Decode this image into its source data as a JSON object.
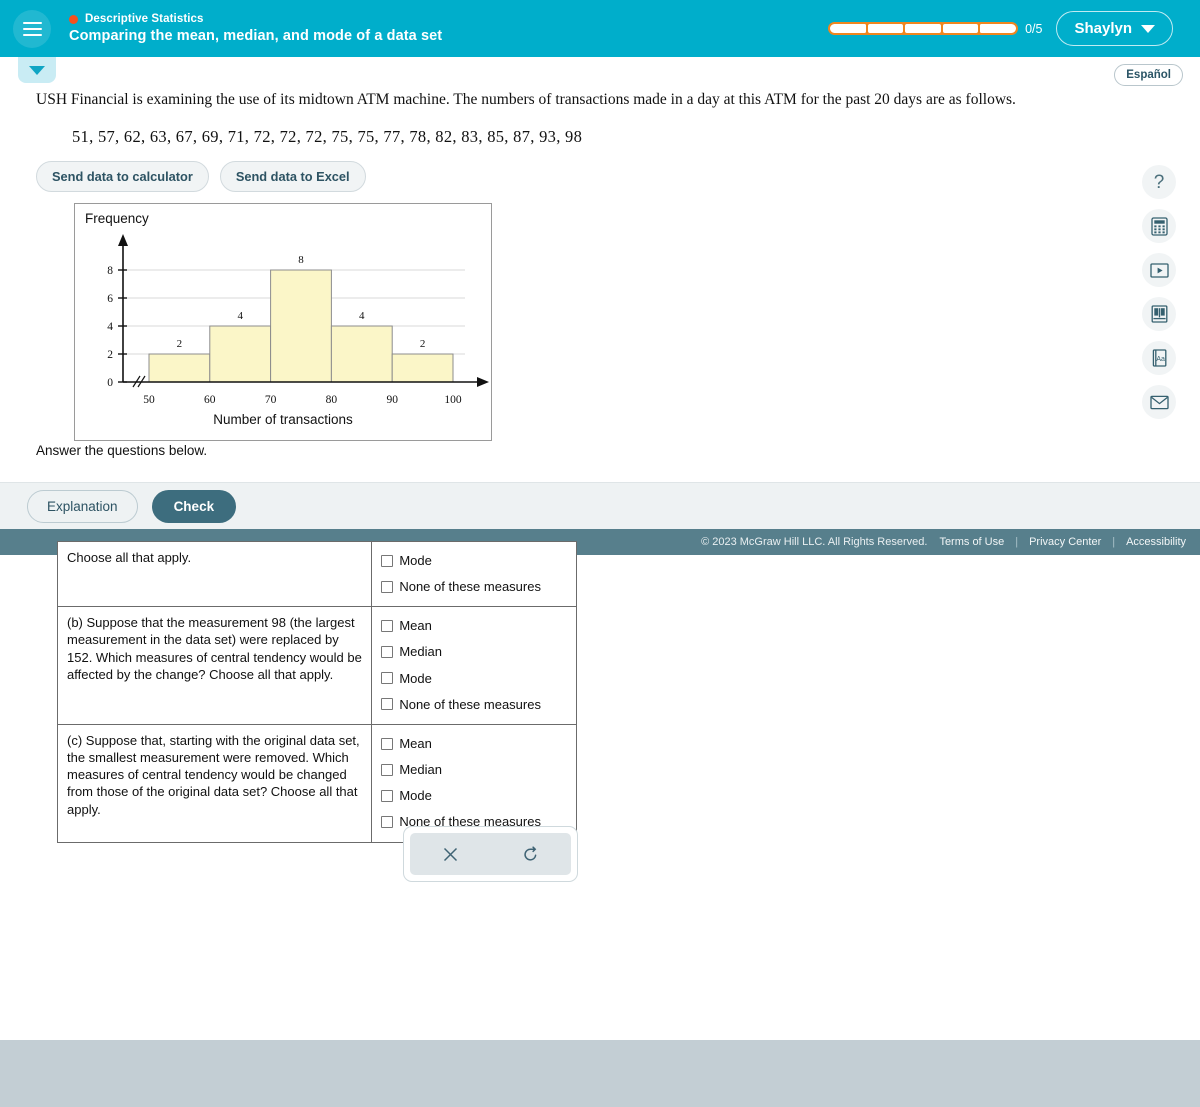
{
  "header": {
    "menu_icon": "hamburger-icon",
    "subject": "Descriptive Statistics",
    "lesson": "Comparing the mean, median, and mode of a data set",
    "progress_label": "0/5",
    "progress_segments": 5,
    "progress_filled": 0,
    "user_name": "Shaylyn",
    "accent_color": "#00aecb",
    "progress_color": "#f0861f"
  },
  "controls": {
    "collapse_tab": "chevron-down-icon",
    "espanol_label": "Español"
  },
  "rail": {
    "items": [
      {
        "name": "help-icon",
        "glyph": "?"
      },
      {
        "name": "calculator-icon",
        "glyph": "calculator"
      },
      {
        "name": "video-icon",
        "glyph": "play"
      },
      {
        "name": "book-icon",
        "glyph": "book"
      },
      {
        "name": "glossary-icon",
        "glyph": "Aa"
      },
      {
        "name": "message-icon",
        "glyph": "envelope"
      }
    ]
  },
  "main": {
    "prompt": "USH Financial is examining the use of its midtown ATM machine. The numbers of transactions made in a day at this ATM for the past 20 days are as follows.",
    "data_values": "51, 57, 62, 63, 67, 69, 71, 72, 72, 72, 75, 75, 77, 78, 82, 83, 85, 87, 93, 98",
    "send_calculator_label": "Send data to calculator",
    "send_excel_label": "Send data to Excel",
    "answer_instruction": "Answer the questions below."
  },
  "chart_data": {
    "type": "bar",
    "title": "",
    "ylabel": "Frequency",
    "xlabel": "Number of transactions",
    "categories": [
      "50-60",
      "60-70",
      "70-80",
      "80-90",
      "90-100"
    ],
    "bin_edges": [
      50,
      60,
      70,
      80,
      90,
      100
    ],
    "values": [
      2,
      4,
      8,
      4,
      2
    ],
    "data_labels": [
      "2",
      "4",
      "8",
      "4",
      "2"
    ],
    "xticks": [
      "50",
      "60",
      "70",
      "80",
      "90",
      "100"
    ],
    "yticks": [
      "0",
      "2",
      "4",
      "6",
      "8"
    ],
    "ylim": [
      0,
      9
    ],
    "xlim": [
      50,
      100
    ],
    "grid": true,
    "axis_break": true,
    "bar_fill": "#fbf6c8",
    "bar_stroke": "#8c8c8c",
    "grid_color": "#d8d8d8",
    "legend": "none"
  },
  "actions": {
    "explanation_label": "Explanation",
    "check_label": "Check"
  },
  "footer": {
    "copyright": "© 2023 McGraw Hill LLC. All Rights Reserved.",
    "links": [
      "Terms of Use",
      "Privacy Center",
      "Accessibility"
    ],
    "separator": "|"
  },
  "questions": [
    {
      "text": "Choose all that apply.",
      "options": [
        "Mode",
        "None of these measures"
      ],
      "clipped_top": true
    },
    {
      "text": "(b) Suppose that the measurement 98 (the largest measurement in the data set) were replaced by 152. Which measures of central tendency would be affected by the change? Choose all that apply.",
      "options": [
        "Mean",
        "Median",
        "Mode",
        "None of these measures"
      ]
    },
    {
      "text": "(c) Suppose that, starting with the original data set, the smallest measurement were removed. Which measures of central tendency would be changed from those of the original data set? Choose all that apply.",
      "options": [
        "Mean",
        "Median",
        "Mode",
        "None of these measures"
      ]
    }
  ],
  "toolbar": {
    "clear_icon": "close-icon",
    "undo_icon": "undo-icon"
  }
}
